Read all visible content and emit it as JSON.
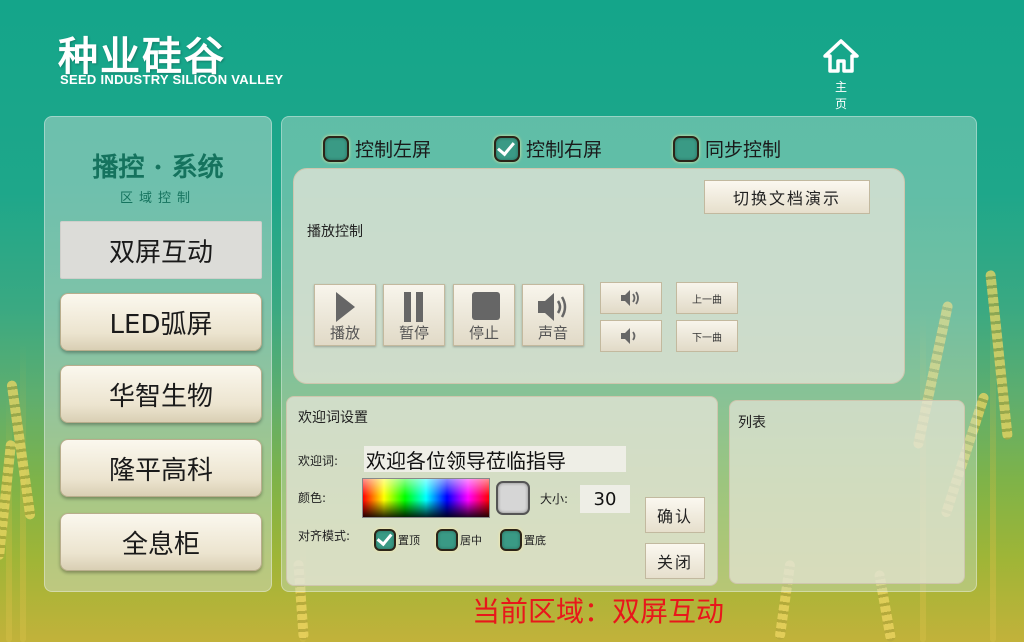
{
  "brand": {
    "title_cn": "种业硅谷",
    "title_en": "SEED INDUSTRY SILICON VALLEY"
  },
  "home": {
    "label": "主 页",
    "icon": "home-icon"
  },
  "sidebar": {
    "title": "播控 · 系统",
    "subtitle": "区域控制",
    "items": [
      {
        "label": "双屏互动",
        "active": true
      },
      {
        "label": "LED弧屏",
        "active": false
      },
      {
        "label": "华智生物",
        "active": false
      },
      {
        "label": "隆平高科",
        "active": false
      },
      {
        "label": "全息柜",
        "active": false
      }
    ]
  },
  "screen_select": [
    {
      "label": "控制左屏",
      "checked": false
    },
    {
      "label": "控制右屏",
      "checked": true
    },
    {
      "label": "同步控制",
      "checked": false
    }
  ],
  "playback": {
    "switch_doc_label": "切换文档演示",
    "section_label": "播放控制",
    "controls": [
      {
        "label": "播放",
        "icon": "play-icon"
      },
      {
        "label": "暂停",
        "icon": "pause-icon"
      },
      {
        "label": "停止",
        "icon": "stop-icon"
      },
      {
        "label": "声音",
        "icon": "speaker-icon"
      }
    ],
    "volume_up_icon": "volume-up-icon",
    "volume_down_icon": "volume-down-icon",
    "prev_label": "上一曲",
    "next_label": "下一曲"
  },
  "welcome": {
    "section_label": "欢迎词设置",
    "text_label": "欢迎词:",
    "text_value": "欢迎各位领导莅临指导",
    "color_label": "颜色:",
    "size_label": "大小:",
    "size_value": "30",
    "align_label": "对齐模式:",
    "align_options": [
      {
        "label": "置顶",
        "checked": true
      },
      {
        "label": "居中",
        "checked": false
      },
      {
        "label": "置底",
        "checked": false
      }
    ],
    "confirm_label": "确认",
    "close_label": "关闭"
  },
  "list": {
    "label": "列表"
  },
  "status": {
    "text": "当前区域：双屏互动"
  },
  "colors": {
    "accent": "#15735e",
    "status": "#e8171b"
  }
}
